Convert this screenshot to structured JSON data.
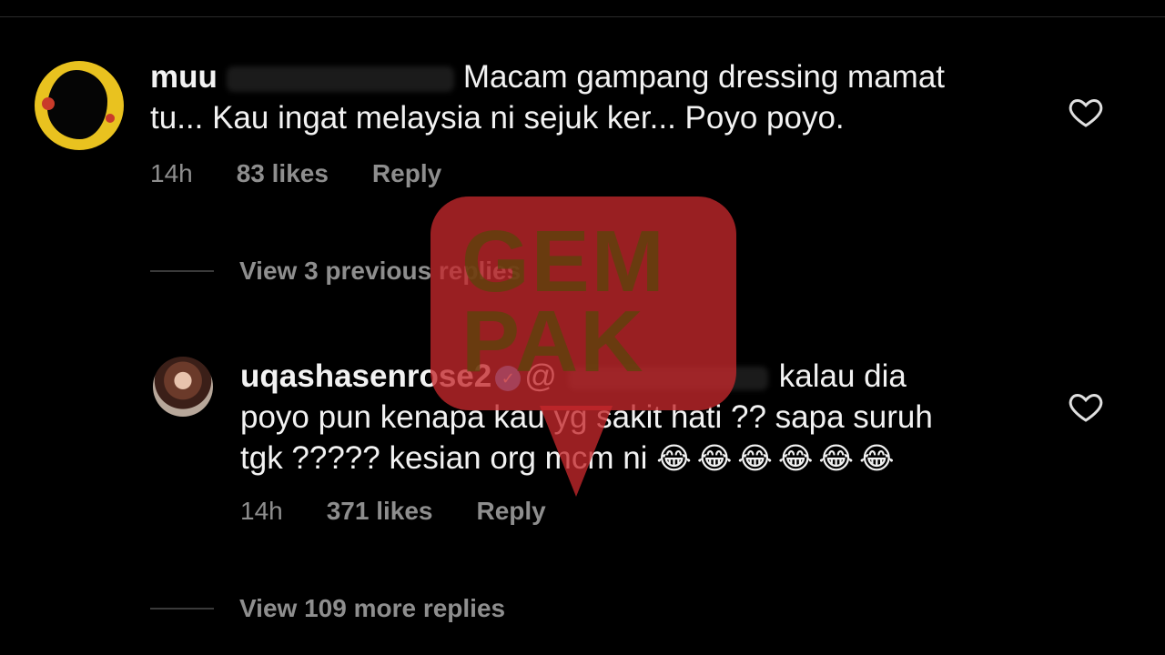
{
  "comments": [
    {
      "username_visible": "muu",
      "text_line1": "Macam gampang dressing mamat",
      "text_line2": "tu... Kau ingat melaysia ni sejuk ker... Poyo poyo.",
      "time": "14h",
      "likes": "83 likes",
      "reply": "Reply"
    },
    {
      "username": "uqashasenrose2",
      "mention_partial": "@",
      "text_tail": "kalau dia",
      "text_line2": "poyo pun kenapa kau yg sakit hati ?? sapa suruh",
      "text_line3": "tgk ????? kesian org mcm ni",
      "emojis": "😂😂😂😂😂😂",
      "time": "14h",
      "likes": "371 likes",
      "reply": "Reply"
    }
  ],
  "view_previous": "View 3 previous replies",
  "view_more": "View 109 more replies",
  "watermark": {
    "line1": "GEM",
    "line2": "PAK"
  },
  "icons": {
    "like": "heart-icon",
    "verified": "verified-badge-icon"
  },
  "colors": {
    "background": "#000000",
    "text": "#f2f2f2",
    "muted": "#8e8e8e",
    "watermark": "#c4282c"
  }
}
